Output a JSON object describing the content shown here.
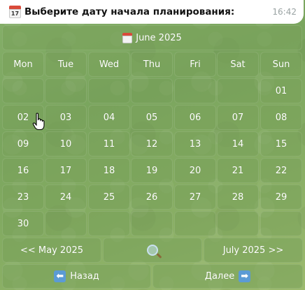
{
  "message": {
    "text": "Выберите дату начала планирования:",
    "time": "16:42",
    "icon": "calendar-icon"
  },
  "calendar": {
    "header_label": "June 2025",
    "weekdays": [
      "Mon",
      "Tue",
      "Wed",
      "Thu",
      "Fri",
      "Sat",
      "Sun"
    ],
    "weeks": [
      [
        "",
        "",
        "",
        "",
        "",
        "",
        "01"
      ],
      [
        "02",
        "03",
        "04",
        "05",
        "06",
        "07",
        "08"
      ],
      [
        "09",
        "10",
        "11",
        "12",
        "13",
        "14",
        "15"
      ],
      [
        "16",
        "17",
        "18",
        "19",
        "20",
        "21",
        "22"
      ],
      [
        "23",
        "24",
        "25",
        "26",
        "27",
        "28",
        "29"
      ],
      [
        "30",
        "",
        "",
        "",
        "",
        "",
        ""
      ]
    ],
    "nav": {
      "prev_label": "<< May 2025",
      "search_icon": "magnifier-icon",
      "next_label": "July 2025 >>"
    },
    "actions": {
      "back_label": "Назад",
      "back_icon": "left-arrow-icon",
      "next_label": "Далее",
      "next_icon": "right-arrow-icon"
    }
  }
}
